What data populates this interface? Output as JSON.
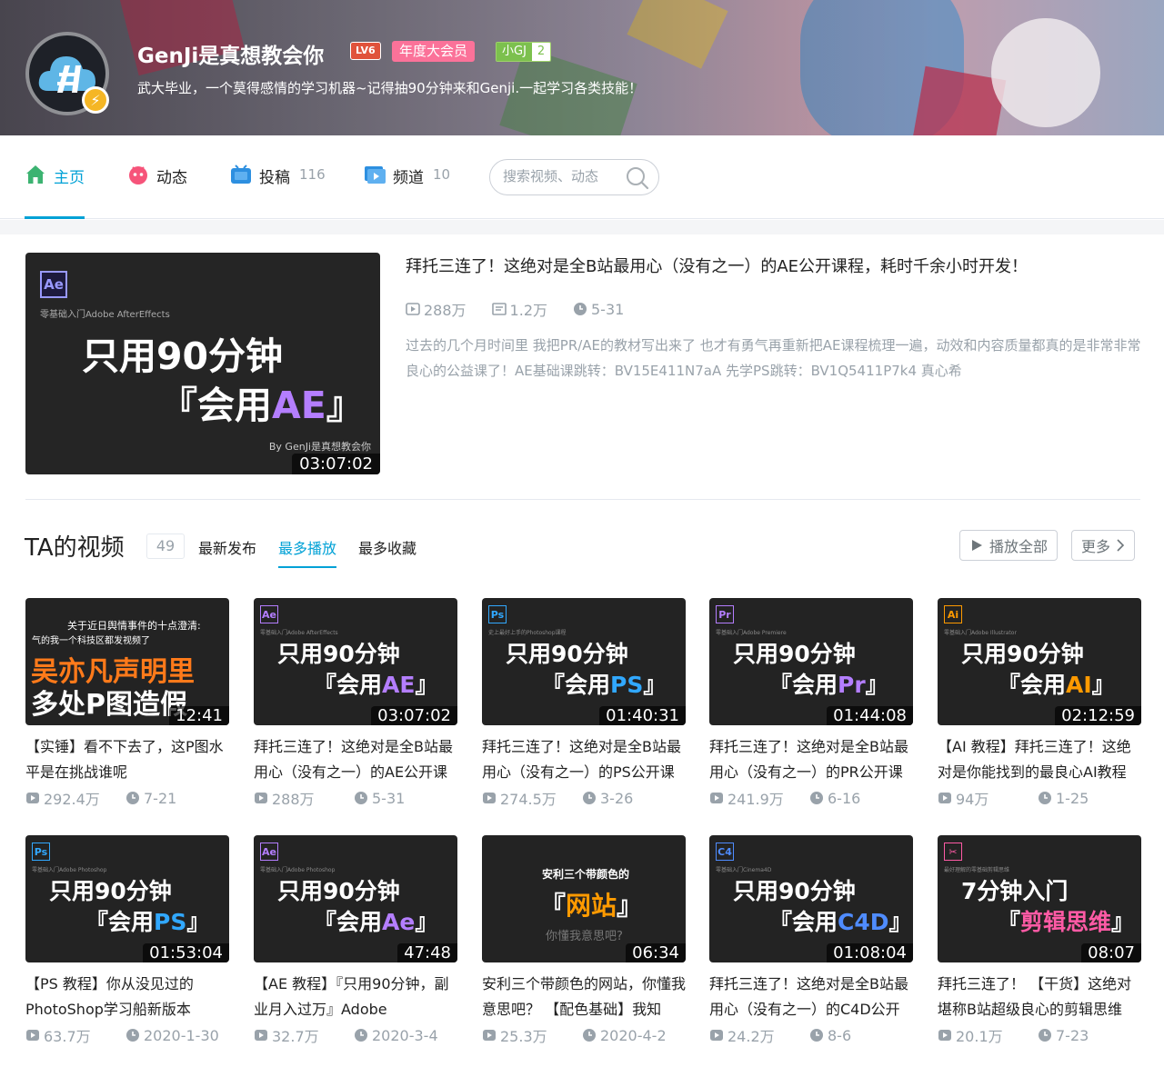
{
  "header": {
    "username": "GenJi是真想教会你",
    "level": "LV6",
    "vip_label": "年度大会员",
    "fan_medal_name": "小GJ",
    "fan_medal_level": "2",
    "signature": "武大毕业，一个莫得感情的学习机器~记得抽90分钟来和Genji.一起学习各类技能！"
  },
  "nav": {
    "tabs": [
      {
        "label": "主页",
        "count": "",
        "icon": "home-icon"
      },
      {
        "label": "动态",
        "count": "",
        "icon": "dynamic-icon"
      },
      {
        "label": "投稿",
        "count": "116",
        "icon": "upload-icon"
      },
      {
        "label": "频道",
        "count": "10",
        "icon": "channel-icon"
      }
    ],
    "search_placeholder": "搜索视频、动态"
  },
  "featured": {
    "title": "拜托三连了！这绝对是全B站最用心（没有之一）的AE公开课程，耗时千余小时开发！",
    "views": "288万",
    "comments": "1.2万",
    "date": "5-31",
    "description": "过去的几个月时间里 我把PR/AE的教材写出来了 也才有勇气再重新把AE课程梳理一遍，动效和内容质量都真的是非常非常良心的公益课了！AE基础课跳转：BV15E411N7aA 先学PS跳转：BV1Q5411P7k4 真心希",
    "cover": {
      "badge": "Ae",
      "small_text": "零基础入门Adobe AfterEffects",
      "line1": "只用90分钟",
      "line2_prefix": "『会用",
      "line2_highlight": "AE",
      "line2_suffix": "』",
      "byline": "By GenJi是真想教会你",
      "duration": "03:07:02"
    }
  },
  "videos": {
    "heading": "TA的视频",
    "count": "49",
    "sort_tabs": [
      "最新发布",
      "最多播放",
      "最多收藏"
    ],
    "active_sort": "最多播放",
    "play_all_label": "播放全部",
    "more_label": "更多",
    "items": [
      {
        "title": "【实锤】看不下去了，这P图水平是在挑战谁呢",
        "views": "292.4万",
        "date": "7-21",
        "duration": "12:41",
        "cover_badge": "",
        "cover_small": "气的我一个科技区都发视频了",
        "cover_line1": "吴亦凡声明里",
        "cover_line2": "多处P图造假",
        "cover_top": "关于近日舆情事件的十点澄清:",
        "accent": "#ff7a1a"
      },
      {
        "title": "拜托三连了！这绝对是全B站最用心（没有之一）的AE公开课",
        "views": "288万",
        "date": "5-31",
        "duration": "03:07:02",
        "cover_badge": "Ae",
        "cover_small": "零基础入门Adobe AfterEffects",
        "cover_line1": "只用90分钟",
        "cover_line2_prefix": "『会用",
        "cover_line2_hl": "AE",
        "accent": "#b47eff"
      },
      {
        "title": "拜托三连了！这绝对是全B站最用心（没有之一）的PS公开课",
        "views": "274.5万",
        "date": "3-26",
        "duration": "01:40:31",
        "cover_badge": "Ps",
        "cover_small": "史上最好上手的Photoshop课程",
        "cover_line1": "只用90分钟",
        "cover_line2_prefix": "『会用",
        "cover_line2_hl": "PS",
        "accent": "#31a8ff"
      },
      {
        "title": "拜托三连了！这绝对是全B站最用心（没有之一）的PR公开课",
        "views": "241.9万",
        "date": "6-16",
        "duration": "01:44:08",
        "cover_badge": "Pr",
        "cover_small": "零基础入门Adobe Premiere",
        "cover_line1": "只用90分钟",
        "cover_line2_prefix": "『会用",
        "cover_line2_hl": "Pr",
        "accent": "#b47eff"
      },
      {
        "title": "【AI 教程】拜托三连了！这绝对是你能找到的最良心AI教程",
        "views": "94万",
        "date": "1-25",
        "duration": "02:12:59",
        "cover_badge": "Ai",
        "cover_small": "零基础入门Adobe Illustrator",
        "cover_line1": "只用90分钟",
        "cover_line2_prefix": "『会用",
        "cover_line2_hl": "AI",
        "accent": "#ff9a00"
      },
      {
        "title": "【PS 教程】你从没见过的PhotoShop学习船新版本",
        "views": "63.7万",
        "date": "2020-1-30",
        "duration": "01:53:04",
        "cover_badge": "Ps",
        "cover_small": "零基础入门Adobe Photoshop",
        "cover_line1": "只用90分钟",
        "cover_line2_prefix": "『会用",
        "cover_line2_hl": "PS",
        "accent": "#31a8ff"
      },
      {
        "title": "【AE 教程】『只用90分钟，副业月入过万』Adobe",
        "views": "32.7万",
        "date": "2020-3-4",
        "duration": "47:48",
        "cover_badge": "Ae",
        "cover_small": "零基础入门Adobe Photoshop",
        "cover_line1": "只用90分钟",
        "cover_line2_prefix": "『会用",
        "cover_line2_hl": "Ae",
        "accent": "#b47eff"
      },
      {
        "title": "安利三个带颜色的网站，你懂我意思吧？ 【配色基础】我知",
        "views": "25.3万",
        "date": "2020-4-2",
        "duration": "06:34",
        "cover_badge": "",
        "cover_small": "你懂我意思吧?",
        "cover_line1": "安利三个带颜色的",
        "cover_line2_prefix": "『",
        "cover_line2_hl": "网站",
        "accent": "#ff9a00"
      },
      {
        "title": "拜托三连了！这绝对是全B站最用心（没有之一）的C4D公开课",
        "views": "24.2万",
        "date": "8-6",
        "duration": "01:08:04",
        "cover_badge": "C4",
        "cover_small": "零基础入门Cinema4D",
        "cover_line1": "只用90分钟",
        "cover_line2_prefix": "『会用",
        "cover_line2_hl": "C4D",
        "accent": "#4f8cff"
      },
      {
        "title": "拜托三连了！ 【干货】这绝对堪称B站超级良心的剪辑思维",
        "views": "20.1万",
        "date": "7-23",
        "duration": "08:07",
        "cover_badge": "✂",
        "cover_small": "最好理解的零基础剪辑思维",
        "cover_line1": "7分钟入门",
        "cover_line2_prefix": "『",
        "cover_line2_hl": "剪辑思维",
        "accent": "#ff5aa5"
      }
    ]
  },
  "colors": {
    "accent": "#00a1d6",
    "pink": "#fb7299",
    "muted": "#99a2aa"
  }
}
